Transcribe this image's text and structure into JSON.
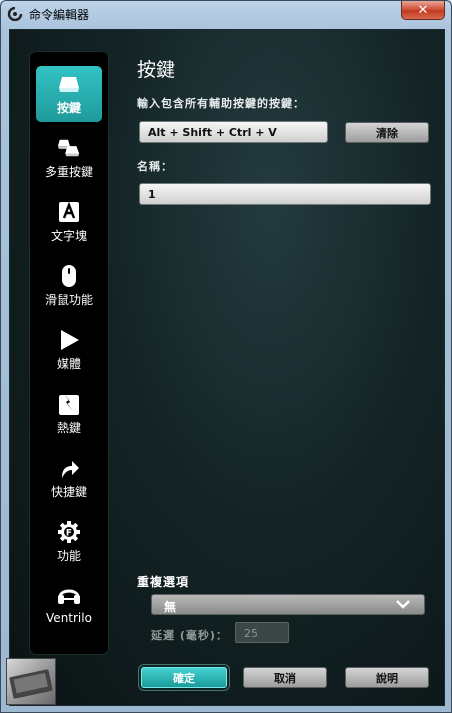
{
  "window": {
    "title": "命令編輯器",
    "close_glyph": "✕"
  },
  "sidebar": {
    "items": [
      {
        "label": "按鍵",
        "icon": "keycap-icon",
        "active": true
      },
      {
        "label": "多重按鍵",
        "icon": "multi-keycap-icon",
        "active": false
      },
      {
        "label": "文字塊",
        "icon": "text-block-icon",
        "active": false
      },
      {
        "label": "滑鼠功能",
        "icon": "mouse-icon",
        "active": false
      },
      {
        "label": "媒體",
        "icon": "play-icon",
        "active": false
      },
      {
        "label": "熱鍵",
        "icon": "hotkey-icon",
        "active": false
      },
      {
        "label": "快捷鍵",
        "icon": "shortcut-arrow-icon",
        "active": false
      },
      {
        "label": "功能",
        "icon": "function-gear-icon",
        "active": false
      },
      {
        "label": "Ventrilo",
        "icon": "headset-icon",
        "active": false
      }
    ]
  },
  "main": {
    "heading": "按鍵",
    "keystroke_label": "輸入包含所有輔助按鍵的按鍵：",
    "keystroke_value": "Alt + Shift + Ctrl + V",
    "clear_button": "清除",
    "name_label": "名稱：",
    "name_value": "1",
    "repeat_label": "重複選項",
    "repeat_value": "無",
    "delay_label": "延遲 (毫秒)：",
    "delay_value": "25"
  },
  "footer": {
    "ok": "確定",
    "cancel": "取消",
    "help": "說明"
  },
  "colors": {
    "accent": "#2bb4b5",
    "sidebar_bg": "#000000",
    "panel_bg": "#142426"
  }
}
